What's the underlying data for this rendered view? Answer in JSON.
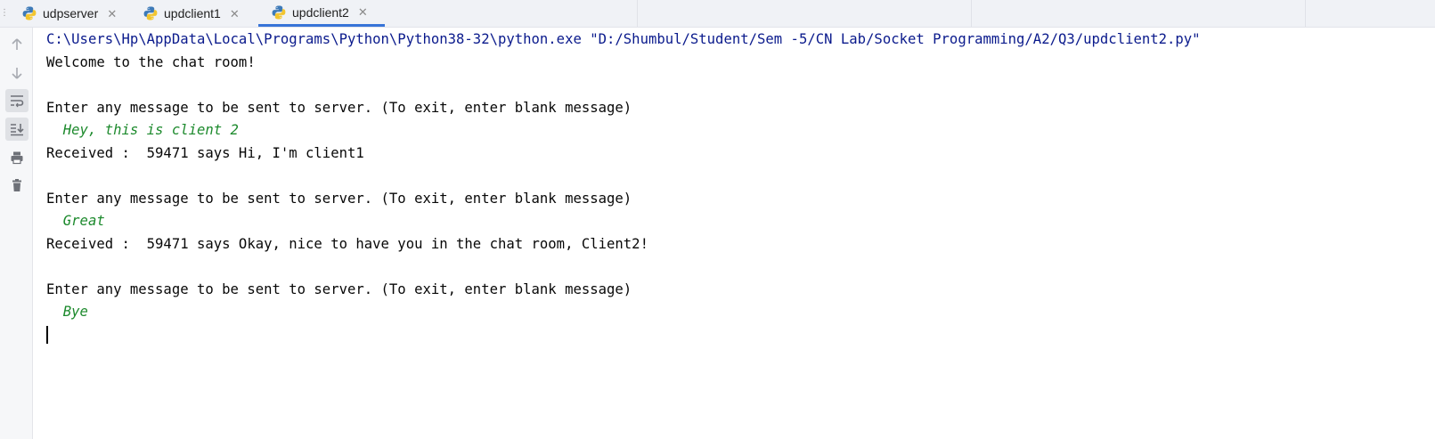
{
  "tabs": [
    {
      "label": "udpserver",
      "active": false
    },
    {
      "label": "updclient1",
      "active": false
    },
    {
      "label": "updclient2",
      "active": true
    }
  ],
  "gutter": {
    "icons": [
      "arrow-up-icon",
      "arrow-down-icon",
      "soft-wrap-icon",
      "scroll-to-end-icon",
      "print-icon",
      "trash-icon"
    ]
  },
  "console": {
    "lines": [
      {
        "text": "C:\\Users\\Hp\\AppData\\Local\\Programs\\Python\\Python38-32\\python.exe \"D:/Shumbul/Student/Sem -5/CN Lab/Socket Programming/A2/Q3/updclient2.py\"",
        "kind": "cmd"
      },
      {
        "text": "Welcome to the chat room!",
        "kind": "out"
      },
      {
        "text": "",
        "kind": "out"
      },
      {
        "text": "Enter any message to be sent to server. (To exit, enter blank message)",
        "kind": "out"
      },
      {
        "text": "  Hey, this is client 2",
        "kind": "input"
      },
      {
        "text": "Received :  59471 says Hi, I'm client1",
        "kind": "out"
      },
      {
        "text": "",
        "kind": "out"
      },
      {
        "text": "Enter any message to be sent to server. (To exit, enter blank message)",
        "kind": "out"
      },
      {
        "text": "  Great",
        "kind": "input"
      },
      {
        "text": "Received :  59471 says Okay, nice to have you in the chat room, Client2!",
        "kind": "out"
      },
      {
        "text": "",
        "kind": "out"
      },
      {
        "text": "Enter any message to be sent to server. (To exit, enter blank message)",
        "kind": "out"
      },
      {
        "text": "  Bye",
        "kind": "input"
      }
    ]
  },
  "colors": {
    "command": "#0a1a8c",
    "user_input": "#1d8a2d",
    "output": "#080808",
    "active_tab_underline": "#3874d8"
  }
}
